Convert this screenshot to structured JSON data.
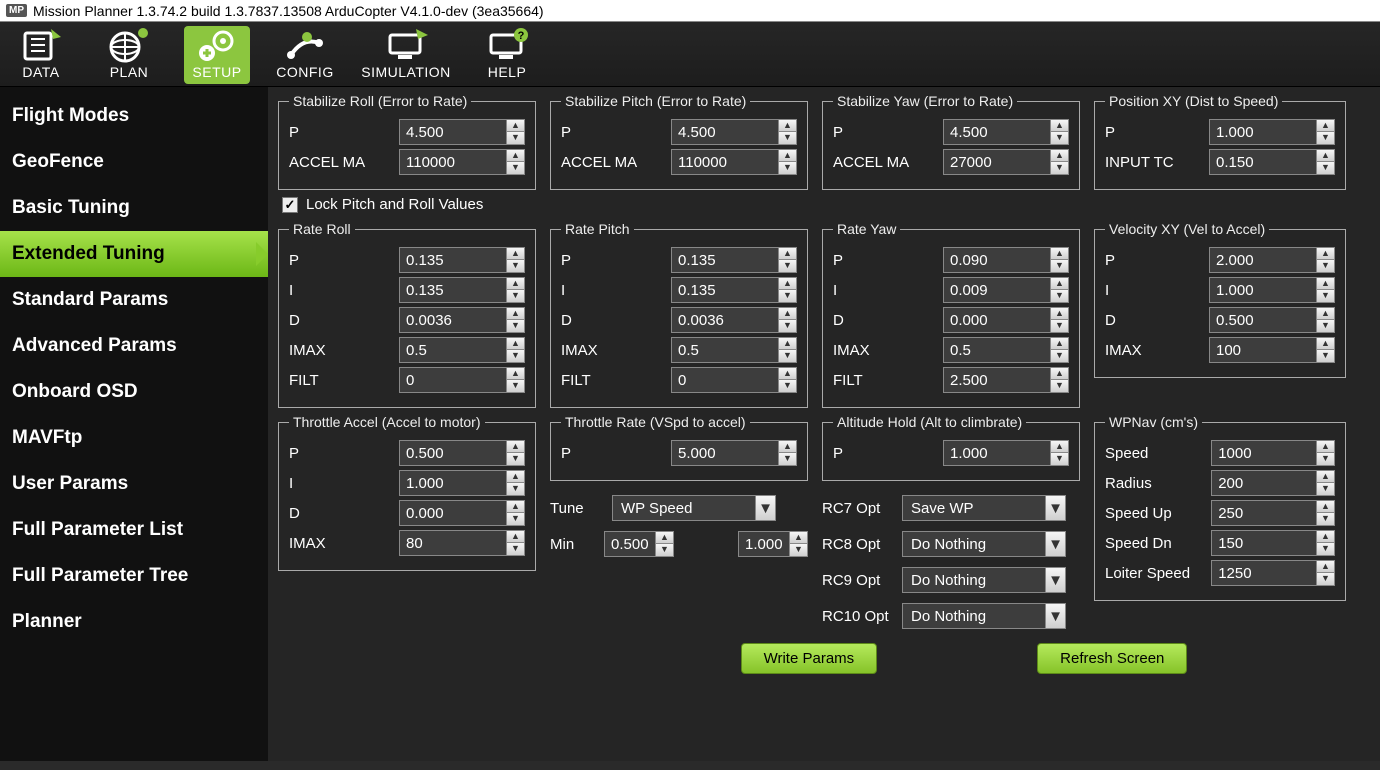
{
  "titlebar": "Mission Planner 1.3.74.2 build 1.3.7837.13508 ArduCopter V4.1.0-dev (3ea35664)",
  "toolbar": {
    "data": "DATA",
    "plan": "PLAN",
    "setup": "SETUP",
    "config": "CONFIG",
    "simulation": "SIMULATION",
    "help": "HELP"
  },
  "sidebar": {
    "items": [
      "Flight Modes",
      "GeoFence",
      "Basic Tuning",
      "Extended Tuning",
      "Standard Params",
      "Advanced Params",
      "Onboard OSD",
      "MAVFtp",
      "User Params",
      "Full Parameter List",
      "Full Parameter Tree",
      "Planner"
    ],
    "active": 3
  },
  "labels": {
    "p": "P",
    "i": "I",
    "d": "D",
    "imax": "IMAX",
    "filt": "FILT",
    "accelma": "ACCEL MA",
    "inputtc": "INPUT TC",
    "speed": "Speed",
    "radius": "Radius",
    "speedup": "Speed Up",
    "speeddn": "Speed Dn",
    "loiterspeed": "Loiter Speed",
    "tune": "Tune",
    "min": "Min",
    "rc7": "RC7 Opt",
    "rc8": "RC8 Opt",
    "rc9": "RC9 Opt",
    "rc10": "RC10 Opt",
    "lockpitchroll": "Lock Pitch and Roll Values"
  },
  "groups": {
    "stabroll": {
      "title": "Stabilize Roll (Error to Rate)",
      "p": "4.500",
      "accel": "110000"
    },
    "stabpitch": {
      "title": "Stabilize Pitch (Error to Rate)",
      "p": "4.500",
      "accel": "110000"
    },
    "stabyaw": {
      "title": "Stabilize Yaw (Error to Rate)",
      "p": "4.500",
      "accel": "27000"
    },
    "posxy": {
      "title": "Position XY (Dist to Speed)",
      "p": "1.000",
      "inputtc": "0.150"
    },
    "rateroll": {
      "title": "Rate Roll",
      "p": "0.135",
      "i": "0.135",
      "d": "0.0036",
      "imax": "0.5",
      "filt": "0"
    },
    "ratepitch": {
      "title": "Rate Pitch",
      "p": "0.135",
      "i": "0.135",
      "d": "0.0036",
      "imax": "0.5",
      "filt": "0"
    },
    "rateyaw": {
      "title": "Rate Yaw",
      "p": "0.090",
      "i": "0.009",
      "d": "0.000",
      "imax": "0.5",
      "filt": "2.500"
    },
    "velxy": {
      "title": "Velocity XY (Vel to Accel)",
      "p": "2.000",
      "i": "1.000",
      "d": "0.500",
      "imax": "100"
    },
    "thraccel": {
      "title": "Throttle Accel (Accel to motor)",
      "p": "0.500",
      "i": "1.000",
      "d": "0.000",
      "imax": "80"
    },
    "thrrate": {
      "title": "Throttle Rate (VSpd to accel)",
      "p": "5.000"
    },
    "althold": {
      "title": "Altitude Hold (Alt to climbrate)",
      "p": "1.000"
    },
    "wpnav": {
      "title": "WPNav (cm's)",
      "speed": "1000",
      "radius": "200",
      "speedup": "250",
      "speeddn": "150",
      "loiter": "1250"
    }
  },
  "tune": {
    "sel": "WP Speed",
    "min": "0.500",
    "max": "1.000"
  },
  "rcopts": {
    "rc7": "Save WP",
    "rc8": "Do Nothing",
    "rc9": "Do Nothing",
    "rc10": "Do Nothing"
  },
  "buttons": {
    "write": "Write Params",
    "refresh": "Refresh Screen"
  }
}
